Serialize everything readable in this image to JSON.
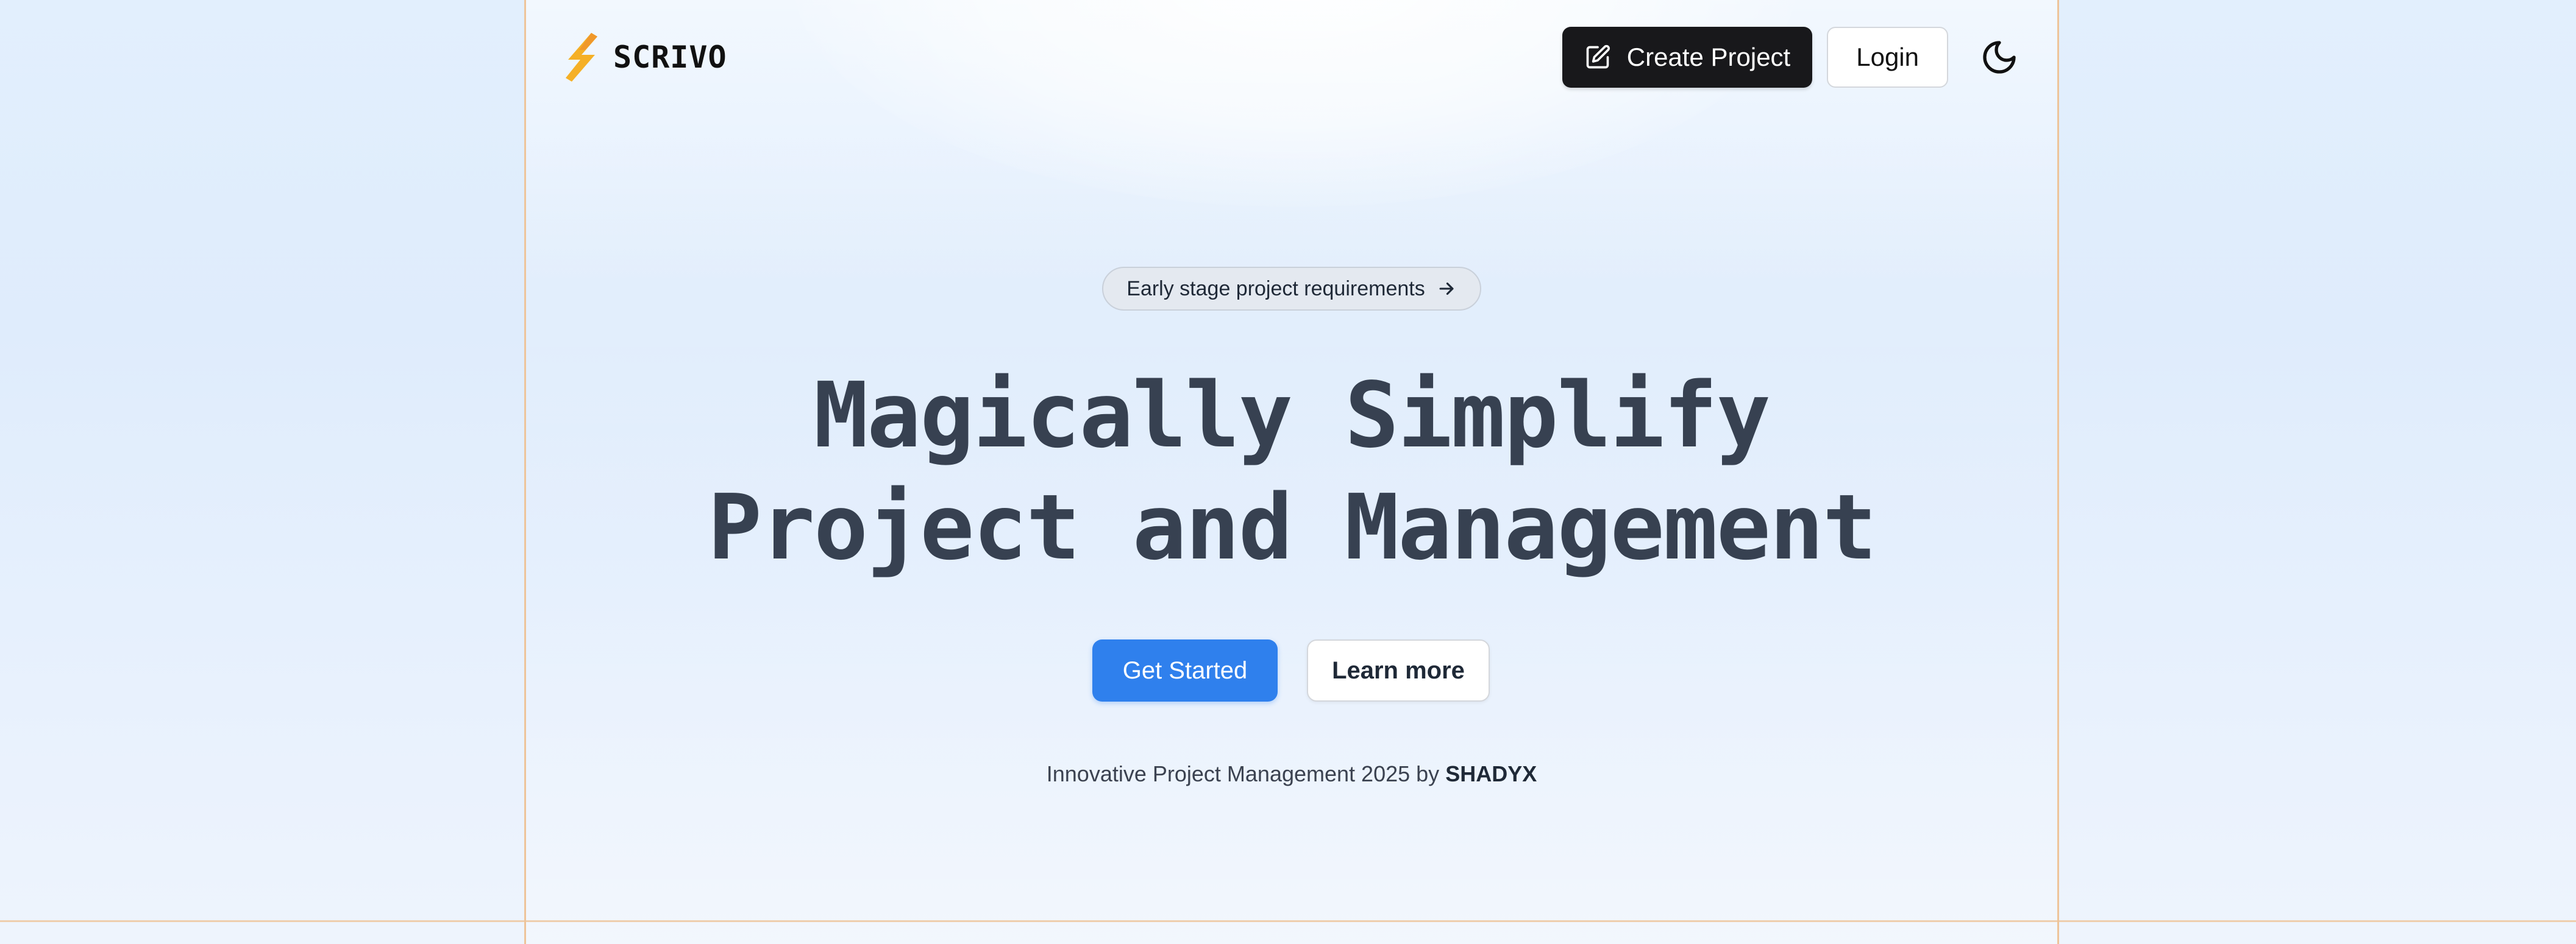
{
  "brand": {
    "name": "SCRIVO",
    "accent_color": "#f5b026"
  },
  "header": {
    "create_project_label": "Create Project",
    "create_project_icon": "edit-icon",
    "login_label": "Login",
    "theme_toggle_icon": "moon-icon"
  },
  "hero": {
    "badge_label": "Early stage project requirements",
    "badge_icon": "arrow-right-icon",
    "headline_line1": "Magically Simplify",
    "headline_line2": "Project and Management",
    "primary_cta": "Get Started",
    "secondary_cta": "Learn more",
    "footer_text": "Innovative Project Management 2025 by",
    "footer_author": "SHADYX"
  },
  "colors": {
    "primary": "#2f80ed",
    "dark_button": "#18181b",
    "headline": "#374151",
    "frame_border": "#eec49a",
    "background": "#e2effd"
  }
}
